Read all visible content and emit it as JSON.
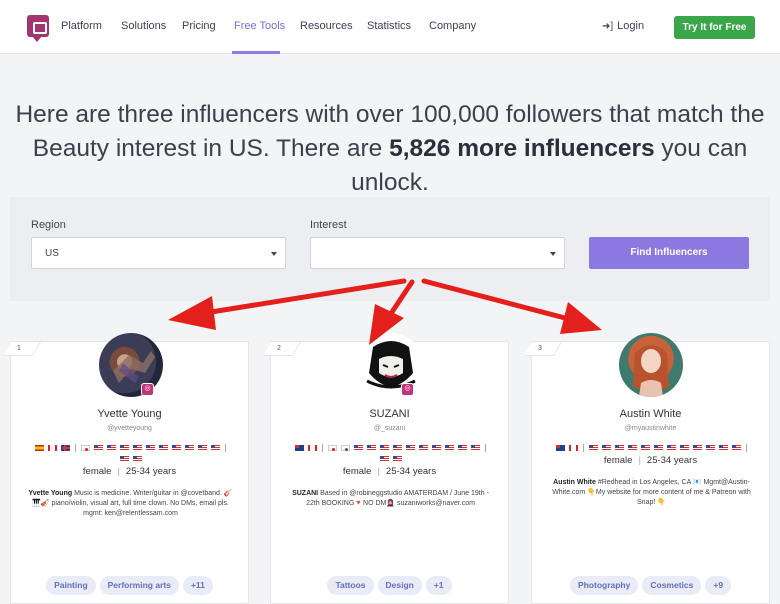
{
  "nav": {
    "items": [
      "Platform",
      "Solutions",
      "Pricing",
      "Free Tools",
      "Resources",
      "Statistics",
      "Company"
    ],
    "login": "Login",
    "cta": "Try It for Free"
  },
  "headline": {
    "line1": "Here are three influencers with over 100,000 followers that match the",
    "line2_a": "Beauty interest in US. There are ",
    "line2_bold": "5,826 more influencers",
    "line2_b": " you can unlock."
  },
  "filters": {
    "region_label": "Region",
    "region_value": "US",
    "interest_label": "Interest",
    "interest_value": "",
    "find_button": "Find Influencers"
  },
  "cards": [
    {
      "rank": "1",
      "name": "Yvette Young",
      "handle": "@yvetteyoung",
      "gender": "female",
      "age": "25-34 years",
      "bio_name": "Yvette Young",
      "bio": "Music is medicine. Writer/guitar in @covetband. 🎸 🎹🎻 piano/violin, visual art, full time clown. No DMs, email pls. mgmt: ken@relentlessam.com",
      "tags": [
        "Painting",
        "Performing arts",
        "+11"
      ]
    },
    {
      "rank": "2",
      "name": "SUZANI",
      "handle": "@_suzani",
      "gender": "female",
      "age": "25-34 years",
      "bio_name": "SUZANI",
      "bio": "Based in @robineggstudio AMATERDAM / June 19th - 22th BOOKING🔻NO DM🧕 suzaniworks@naver.com",
      "tags": [
        "Tattoos",
        "Design",
        "+1"
      ]
    },
    {
      "rank": "3",
      "name": "Austin White",
      "handle": "@myaustinwhite",
      "gender": "female",
      "age": "25-34 years",
      "bio_name": "Austin White",
      "bio": "#Redhead in Los Angeles, CA 📧 Mgmt@Austin-White.com 👇My website for more content of me & Patreon with Snap! 👇",
      "tags": [
        "Photography",
        "Cosmetics",
        "+9"
      ]
    }
  ],
  "colors": {
    "accent": "#8b78e0",
    "cta_green": "#3aa64a",
    "arrow_red": "#e3201b",
    "logo": "#a0356f"
  }
}
